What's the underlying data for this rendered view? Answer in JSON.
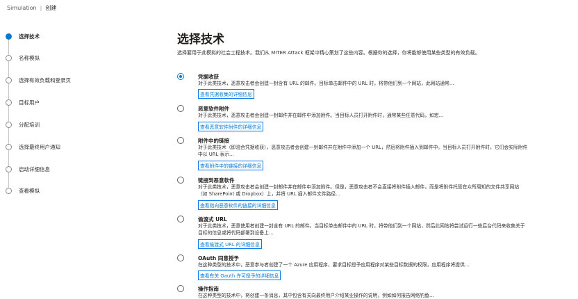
{
  "breadcrumb": {
    "root": "Simulation",
    "current": "创建"
  },
  "steps": [
    {
      "label": "选择技术",
      "active": true
    },
    {
      "label": "名称模拟",
      "active": false
    },
    {
      "label": "选择有效负载和登录页",
      "active": false
    },
    {
      "label": "目标用户",
      "active": false
    },
    {
      "label": "分配培训",
      "active": false
    },
    {
      "label": "选择最终用户通知",
      "active": false
    },
    {
      "label": "启动详细信息",
      "active": false
    },
    {
      "label": "查看模拟",
      "active": false
    }
  ],
  "main": {
    "title": "选择技术",
    "subtitle": "选择要用于此模拟的社会工程技术。我们从 MITER Attack 框架中精心策划了这些内容。根据你的选择，你将能够使用某些类型的有效负载。",
    "options": [
      {
        "name": "凭据收获",
        "desc": "对于此类技术，恶意攻击者会创建一封含有 URL 的邮件。目标单击邮件中的 URL 时，将带他们到一个网站，此网站通常…",
        "link": "查看凭据收集的详细信息",
        "checked": true
      },
      {
        "name": "恶意软件附件",
        "desc": "对于此类技术，恶意攻击者会创建一封邮件并在邮件中添加附件。当目标人员打开附件时，通常某些任意代码，如宏…",
        "link": "查看恶意软件附件的详细信息",
        "checked": false
      },
      {
        "name": "附件中的链接",
        "desc": "对于此类技术（即混合凭据收获），恶意攻击者会创建一封邮件并在附件中添加一个 URL，然后将附件插入到邮件中。当目标人员打开附件时，它们会实际附件中以 URL 表示…",
        "link": "查看附件中的链接的详细信息",
        "checked": false
      },
      {
        "name": "链接到恶意软件",
        "desc": "对于此类技术，恶意攻击者会创建一封邮件并在邮件中添加附件。但是，恶意攻击者不会直接将附件插入邮件，而是将附件托管在众所周知的文件共享网站（如 SharePoint 或 Dropbox）上，并将 URL 插入邮件文件路径…",
        "link": "查看指向恶意软件的链接的详细信息",
        "checked": false
      },
      {
        "name": "偷渡式 URL",
        "desc": "对于此类技术，恶意使用者创建一封含有 URL 的邮件。当目标单击邮件中的 URL 时，将带他们到一个网站，然后此网站将尝试运行一些后台代码来收集关于目标的信息或将代码部署到设备上…",
        "link": "查看偷渡式 URL 的详细信息",
        "checked": false
      },
      {
        "name": "OAuth 同意授予",
        "desc": "在这种类型的技术中，恶意参与者创建了一个 Azure 应用程序，要求目标授予应用程序对某些目标数据的权限，应用程序将提供…",
        "link": "查看有关 Oauth 许可授予的详细信息",
        "checked": false
      },
      {
        "name": "操作指南",
        "desc": "在这种类型的技术中，将创建一条消息，其中包含有关向最终用户介绍某业操作的说明，例如如何报告网络钓鱼…",
        "link": "",
        "checked": false
      }
    ]
  }
}
